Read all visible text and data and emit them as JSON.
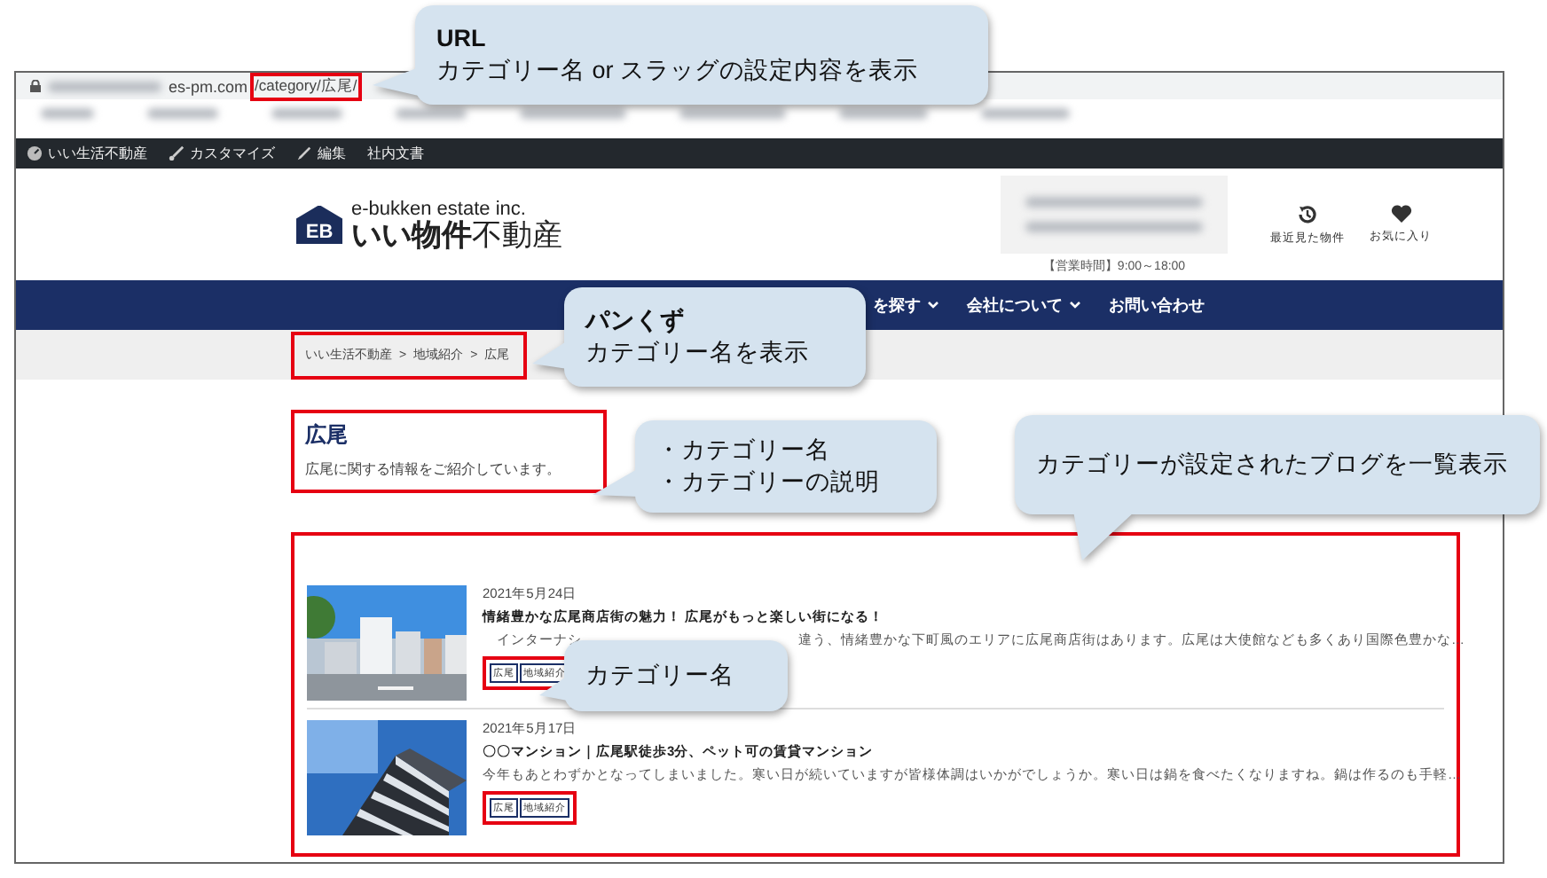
{
  "browser": {
    "url_parts": [
      "es-pm.com",
      "/category/広尾/"
    ]
  },
  "admin_bar": {
    "items": [
      {
        "label": "いい生活不動産",
        "kind": "gauge"
      },
      {
        "label": "カスタマイズ",
        "kind": "brush"
      },
      {
        "label": "編集",
        "kind": "pencil"
      },
      {
        "label": "社内文書",
        "kind": "none"
      }
    ]
  },
  "header": {
    "logo": {
      "mark": "EB",
      "tagline": "e-bukken estate inc.",
      "name": "**いい物件**不動産"
    },
    "hours": "【営業時間】9:00～18:00",
    "actions": [
      {
        "label": "最近見た物件",
        "kind": "history"
      },
      {
        "label": "お気に入り",
        "kind": "heart"
      }
    ]
  },
  "nav": {
    "items": [
      {
        "label": "を探す",
        "dropdown": true
      },
      {
        "label": "会社について",
        "dropdown": true
      },
      {
        "label": "お問い合わせ",
        "dropdown": false
      }
    ]
  },
  "breadcrumb": {
    "separator": ">",
    "items": [
      "いい生活不動産",
      "地域紹介",
      "広尾"
    ]
  },
  "category": {
    "title": "広尾",
    "description": "広尾に関する情報をご紹介しています。"
  },
  "posts": [
    {
      "date": "2021年5月24日",
      "title": "情緒豊かな広尾商店街の魅力！ 広尾がもっと楽しい街になる！",
      "excerpt_parts": [
        "　インターナシ",
        "違う、情緒豊かな下町風のエリアに広尾商店街はあります。広尾は大使館なども多くあり国際色豊かな…"
      ],
      "tags": [
        "広尾",
        "地域紹介"
      ],
      "image": {
        "kind": "picture"
      }
    },
    {
      "date": "2021年5月17日",
      "title": "〇〇マンション｜広尾駅徒歩3分、ペット可の賃貸マンション",
      "excerpt_parts": [
        "今年もあとわずかとなってしまいました。寒い日が続いていますが皆様体調はいかがでしょうか。寒い日は鍋を食べたくなりますね。鍋は作るのも手軽…"
      ],
      "tags": [
        "広尾",
        "地域紹介"
      ],
      "image": {
        "kind": "picture"
      }
    }
  ],
  "annotations": [
    {
      "heading": "URL",
      "lines": [
        "カテゴリー名 or スラッグの設定内容を表示"
      ]
    },
    {
      "heading": "パンくず",
      "lines": [
        "カテゴリー名を表示"
      ]
    },
    {
      "lines": [
        "・カテゴリー名",
        "・カテゴリーの説明"
      ]
    },
    {
      "lines": [
        "カテゴリーが設定されたブログを一覧表示"
      ]
    },
    {
      "lines": [
        "カテゴリー名"
      ]
    }
  ]
}
